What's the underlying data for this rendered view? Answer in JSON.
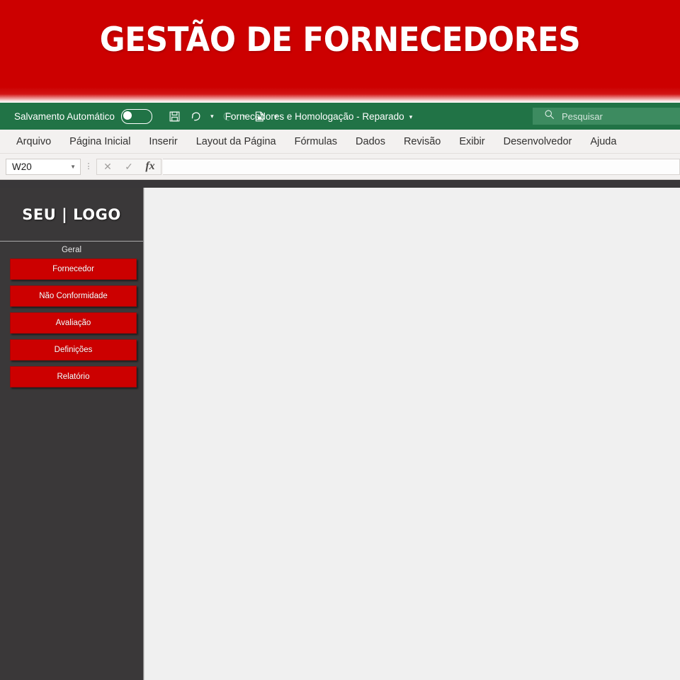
{
  "banner": {
    "title": "GESTÃO DE FORNECEDORES",
    "bg_color": "#cc0000",
    "text_color": "#ffffff"
  },
  "titlebar": {
    "bg_color": "#217346",
    "autosave_label": "Salvamento Automático",
    "autosave_state": "off",
    "document_title": "Fornecedores e Homologação  -  Reparado",
    "quick_access": [
      {
        "name": "save-icon",
        "state": "enabled"
      },
      {
        "name": "undo-icon",
        "state": "enabled"
      },
      {
        "name": "redo-icon",
        "state": "disabled"
      },
      {
        "name": "print-preview-icon",
        "state": "enabled"
      },
      {
        "name": "customize-quick-access-icon",
        "state": "enabled"
      }
    ],
    "search": {
      "placeholder": "Pesquisar",
      "value": ""
    }
  },
  "ribbon": {
    "tabs": [
      {
        "label": "Arquivo"
      },
      {
        "label": "Página Inicial"
      },
      {
        "label": "Inserir"
      },
      {
        "label": "Layout da Página"
      },
      {
        "label": "Fórmulas"
      },
      {
        "label": "Dados"
      },
      {
        "label": "Revisão"
      },
      {
        "label": "Exibir"
      },
      {
        "label": "Desenvolvedor"
      },
      {
        "label": "Ajuda"
      }
    ]
  },
  "formula_bar": {
    "name_box_value": "W20",
    "cancel_glyph": "✕",
    "confirm_glyph": "✓",
    "function_glyph": "fx",
    "formula_value": ""
  },
  "sidebar": {
    "logo_text": "SEU | LOGO",
    "bg_color": "#3a3839",
    "group_label": "Geral",
    "button_color": "#cc0000",
    "buttons": [
      {
        "label": "Fornecedor"
      },
      {
        "label": "Não Conformidade"
      },
      {
        "label": "Avaliação"
      },
      {
        "label": "Definições"
      },
      {
        "label": "Relatório"
      }
    ]
  },
  "workspace": {
    "bg_color": "#f0f0f0",
    "content": ""
  }
}
